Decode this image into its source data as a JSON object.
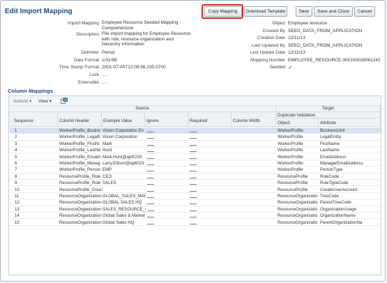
{
  "page": {
    "title": "Edit Import Mapping"
  },
  "buttons": {
    "copy_mapping": "Copy Mapping",
    "download_template": "Download Template",
    "save": "Save",
    "save_and_close": "Save and Close",
    "cancel": "Cancel"
  },
  "form_left": {
    "import_mapping_label": "Import Mapping",
    "import_mapping_value": "Employee Resource Seeded Mapping - Comprehensive",
    "description_label": "Description",
    "description_value": "File import mapping for Employee Resource, with role, resource organization and hierarchy information",
    "delimiter_label": "Delimiter",
    "delimiter_value": "Period",
    "date_format_label": "Date Format",
    "date_format_value": "1/31/99",
    "timestamp_format_label": "Time Stamp Format",
    "timestamp_format_value": "2001-07-04T12:08:56.235-0700",
    "lock_label": "Lock",
    "lock_value": "....",
    "extensible_label": "Extensible",
    "extensible_value": "...."
  },
  "form_right": {
    "object_label": "Object",
    "object_value": "Employee resource",
    "created_by_label": "Created By",
    "created_by_value": "SEED_DATA_FROM_APPLICATION",
    "creation_date_label": "Creation Date",
    "creation_date_value": "12/11/13",
    "last_updated_by_label": "Last Updated By",
    "last_updated_by_value": "SEED_DATA_FROM_APPLICATION",
    "last_update_date_label": "Last Update Date",
    "last_update_date_value": "12/11/13",
    "mapping_number_label": "Mapping Number",
    "mapping_number_value": "EMPLOYEE_RESOURCE-300100028061242",
    "seeded_label": "Seeded",
    "seeded_value": "✓"
  },
  "column_mappings": {
    "title": "Column Mappings",
    "toolbar": {
      "actions": "Actions ▾",
      "view": "View ▾"
    },
    "group_source": "Source",
    "group_target": "Target",
    "duplicate_validation": "Duplicate Validation",
    "headers": {
      "sequence": "Sequence",
      "column_header": "Column Header",
      "example_value": "Example Value",
      "ignore": "Ignore",
      "required": "Required",
      "column_width": "Column Width",
      "object": "Object",
      "attribute": "Attribute"
    },
    "rows": [
      {
        "seq": "1",
        "header": "WorkerProfile_Busine",
        "example": "Vision Corporation En",
        "ignore": "",
        "required": "",
        "object": "WorkerProfile",
        "attribute": "BusinessUnit"
      },
      {
        "seq": "2",
        "header": "WorkerProfile_LegalE",
        "example": "Vision Corporation",
        "ignore": "",
        "required": "",
        "object": "WorkerProfile",
        "attribute": "LegalEntity"
      },
      {
        "seq": "3",
        "header": "WorkerProfile_FirstNi",
        "example": "Mark",
        "ignore": "",
        "required": "",
        "object": "WorkerProfile",
        "attribute": "FirstName"
      },
      {
        "seq": "4",
        "header": "WorkerProfile_LastNe",
        "example": "Hurd",
        "ignore": "",
        "required": "",
        "object": "WorkerProfile",
        "attribute": "LastName"
      },
      {
        "seq": "5",
        "header": "WorkerProfile_EmailA",
        "example": "Mark.Hurd@apt0235",
        "ignore": "",
        "required": "",
        "object": "WorkerProfile",
        "attribute": "EmailAddress"
      },
      {
        "seq": "6",
        "header": "WorkerProfile_Manag",
        "example": "Larry.Ellison@ap6023",
        "ignore": "",
        "required": "",
        "object": "WorkerProfile",
        "attribute": "ManagerEmailAddress"
      },
      {
        "seq": "7",
        "header": "WorkerProfile_Person",
        "example": "EMP",
        "ignore": "",
        "required": "",
        "object": "WorkerProfile",
        "attribute": "PersonType"
      },
      {
        "seq": "8",
        "header": "ResourceProfile_Role",
        "example": "CEO",
        "ignore": "",
        "required": "",
        "object": "ResourceProfile",
        "attribute": "RoleCode"
      },
      {
        "seq": "9",
        "header": "ResourceProfile_Role",
        "example": "SALES",
        "ignore": "",
        "required": "",
        "object": "ResourceProfile",
        "attribute": "RoleTypeCode"
      },
      {
        "seq": "10",
        "header": "ResourceProfile_CreaY",
        "example": "",
        "ignore": "",
        "required": "",
        "object": "ResourceProfile",
        "attribute": "CreateUserAccount"
      },
      {
        "seq": "11",
        "header": "ResourceOrganization",
        "example": "GLOBAL_SALES_MAR",
        "ignore": "",
        "required": "",
        "object": "ResourceOrganizatio",
        "attribute": "TreeCode"
      },
      {
        "seq": "12",
        "header": "ResourceOrganization",
        "example": "GLOBAL SALES HQ",
        "ignore": "",
        "required": "",
        "object": "ResourceOrganizatio",
        "attribute": "ParentTreeCode"
      },
      {
        "seq": "13",
        "header": "ResourceOrganization",
        "example": "SALES_RESOURCE_C",
        "ignore": "",
        "required": "",
        "object": "ResourceOrganizatio",
        "attribute": "OrganizationUsage"
      },
      {
        "seq": "14",
        "header": "ResourceOrganization",
        "example": "Global Sales & Market",
        "ignore": "",
        "required": "",
        "object": "ResourceOrganizatio",
        "attribute": "OrganizationName"
      },
      {
        "seq": "15",
        "header": "ResourceOrganization",
        "example": "Global Sales HQ",
        "ignore": "",
        "required": "",
        "object": "ResourceOrganizatio",
        "attribute": "ParentOrganizationNa"
      }
    ]
  },
  "colors": {
    "title": "#1f4b7a",
    "highlight": "#e02020",
    "selected_row": "#d7e3f2"
  }
}
